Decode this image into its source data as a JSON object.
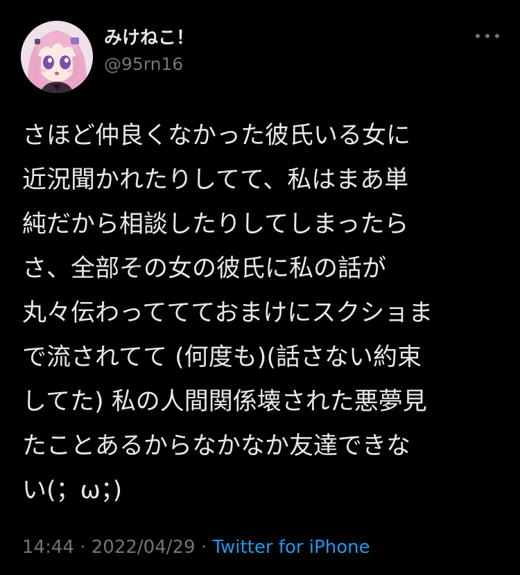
{
  "user": {
    "display_name": "みけねこ！",
    "handle": "@95rn16"
  },
  "tweet": {
    "lines": [
      "さほど仲良くなかった彼氏いる女に",
      "近況聞かれたりしてて、私はまあ単",
      "純だから相談したりしてしまったら",
      "さ、全部その女の彼氏に私の話が",
      "丸々伝わっててておまけにスクショま",
      "で流されてて (何度も)(話さない約束",
      "してた) 私の人間関係壊された悪夢見",
      "たことあるからなかなか友達できな",
      "い(；ω；)"
    ],
    "time": "14:44",
    "separator_1": " · ",
    "date": "2022/04/29",
    "separator_2": " · ",
    "source": "Twitter for iPhone"
  },
  "icons": {
    "more": "more-horizontal-icon",
    "avatar": "anime-girl-avatar"
  },
  "colors": {
    "background": "#000000",
    "text": "#e7e9ea",
    "muted": "#71767b",
    "link": "#1d9bf0"
  }
}
